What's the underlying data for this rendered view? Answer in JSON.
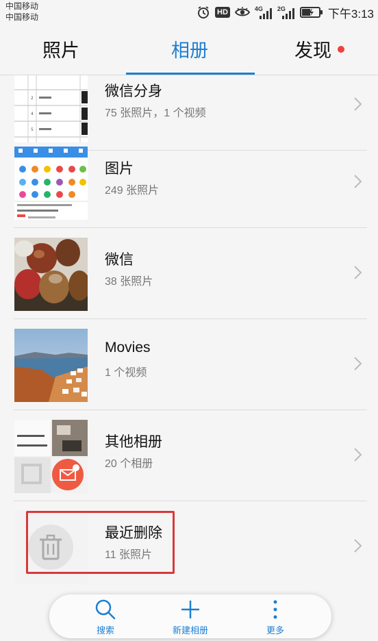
{
  "status": {
    "carrier_1": "中国移动",
    "carrier_2": "中国移动",
    "hd": "HD",
    "net_1": "4G",
    "net_2": "2G",
    "time": "下午3:13"
  },
  "tabs": [
    {
      "label": "照片",
      "active": false
    },
    {
      "label": "相册",
      "active": true
    },
    {
      "label": "发现",
      "active": false,
      "has_badge": true
    }
  ],
  "albums": [
    {
      "name": "微信分身",
      "count": "75 张照片，1 个视频",
      "thumb": "document-screenshot"
    },
    {
      "name": "图片",
      "count": "249 张照片",
      "thumb": "app-screenshot"
    },
    {
      "name": "微信",
      "count": "38 张照片",
      "thumb": "apples-photo"
    },
    {
      "name": "Movies",
      "count": "1 个视频",
      "thumb": "seaside-photo"
    },
    {
      "name": "其他相册",
      "count": "20 个相册",
      "thumb": "collage"
    },
    {
      "name": "最近删除",
      "count": "11 张照片",
      "thumb": "trash-icon"
    }
  ],
  "toolbar": {
    "search_label": "搜索",
    "new_album_label": "新建相册",
    "more_label": "更多"
  },
  "colors": {
    "accent": "#1b7fd4",
    "badge": "#f0403a",
    "highlight": "#d9383a"
  }
}
